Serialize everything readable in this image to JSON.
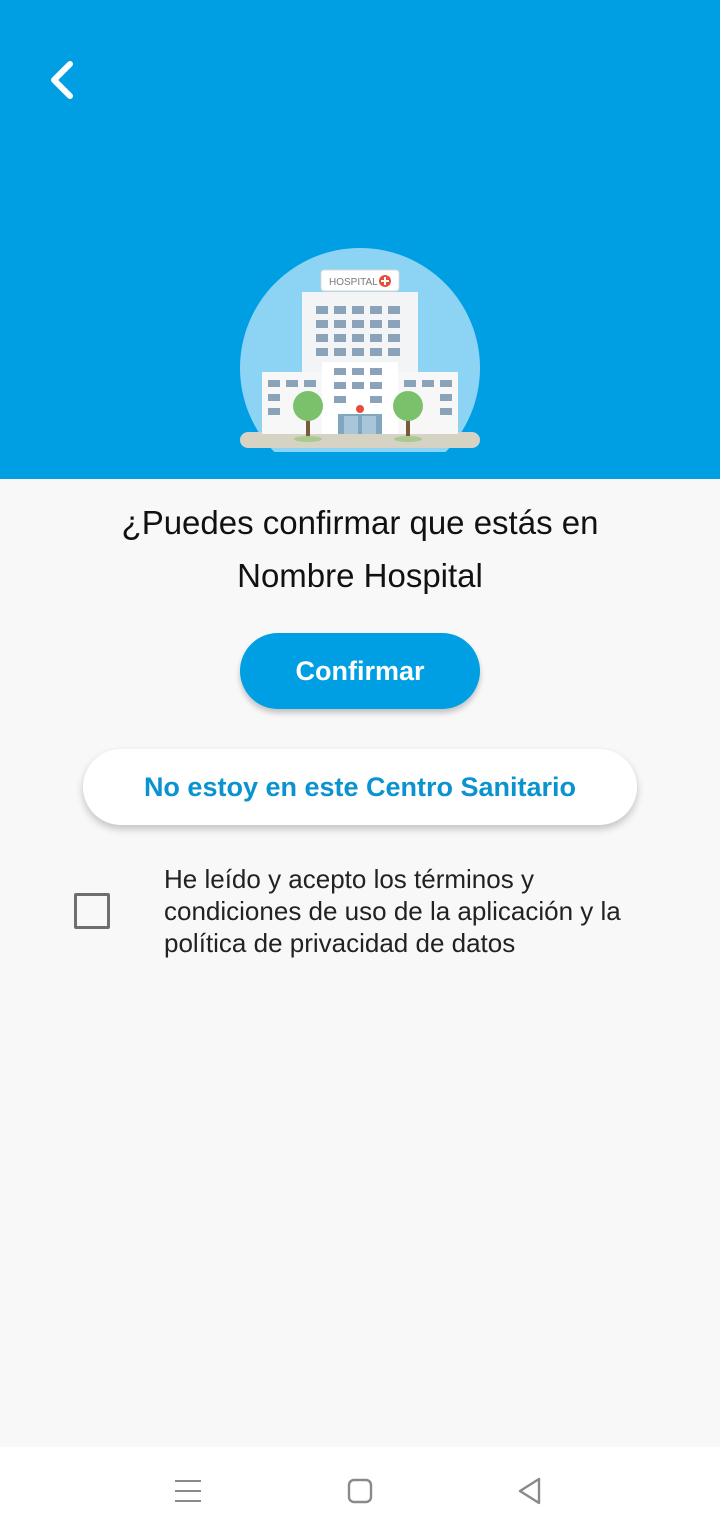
{
  "header": {
    "back_icon": "chevron-left-icon",
    "background_color": "#009fe3",
    "illustration": {
      "icon": "hospital-building-illustration",
      "sign_text": "HOSPITAL"
    }
  },
  "question": {
    "line1": "¿Puedes confirmar que estás en",
    "line2": "Nombre Hospital"
  },
  "buttons": {
    "confirm_label": "Confirmar",
    "not_here_label": "No estoy en este Centro Sanitario"
  },
  "terms": {
    "checked": false,
    "label": "He leído y acepto los términos y condiciones de uso de la aplicación y la política de privacidad de datos"
  },
  "navbar": {
    "icons": [
      "menu-icon",
      "home-square-icon",
      "back-triangle-icon"
    ]
  },
  "colors": {
    "accent": "#009fe3",
    "secondary_text": "#0a93cf",
    "background": "#f8f8f8"
  }
}
